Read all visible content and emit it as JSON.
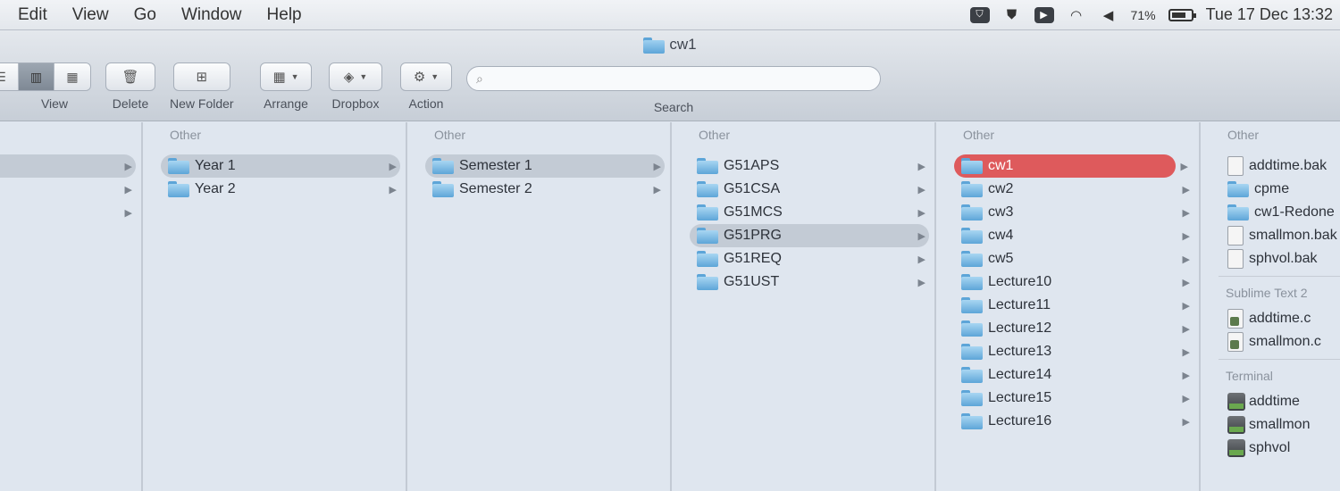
{
  "menubar": {
    "items": [
      "Edit",
      "View",
      "Go",
      "Window",
      "Help"
    ],
    "status": {
      "battery_percent": "71%",
      "clock": "Tue 17 Dec  13:32"
    }
  },
  "window": {
    "title": "cw1"
  },
  "toolbar": {
    "view_label": "View",
    "delete_label": "Delete",
    "new_folder_label": "New Folder",
    "arrange_label": "Arrange",
    "dropbox_label": "Dropbox",
    "action_label": "Action",
    "search_label": "Search",
    "search_value": ""
  },
  "columns": [
    {
      "header": "",
      "items": [
        {
          "name": "",
          "selected": "grey"
        },
        {
          "name": ""
        },
        {
          "name": ""
        }
      ]
    },
    {
      "header": "Other",
      "items": [
        {
          "name": "Year 1",
          "selected": "grey"
        },
        {
          "name": "Year 2"
        }
      ]
    },
    {
      "header": "Other",
      "items": [
        {
          "name": "Semester 1",
          "selected": "grey"
        },
        {
          "name": "Semester 2"
        }
      ]
    },
    {
      "header": "Other",
      "items": [
        {
          "name": "G51APS"
        },
        {
          "name": "G51CSA"
        },
        {
          "name": "G51MCS"
        },
        {
          "name": "G51PRG",
          "selected": "grey"
        },
        {
          "name": "G51REQ"
        },
        {
          "name": "G51UST"
        }
      ]
    },
    {
      "header": "Other",
      "items": [
        {
          "name": "cw1",
          "selected": "red"
        },
        {
          "name": "cw2"
        },
        {
          "name": "cw3"
        },
        {
          "name": "cw4"
        },
        {
          "name": "cw5"
        },
        {
          "name": "Lecture10"
        },
        {
          "name": "Lecture11"
        },
        {
          "name": "Lecture12"
        },
        {
          "name": "Lecture13"
        },
        {
          "name": "Lecture14"
        },
        {
          "name": "Lecture15"
        },
        {
          "name": "Lecture16"
        }
      ]
    }
  ],
  "preview": {
    "other_header": "Other",
    "other_items": [
      "addtime.bak",
      "cpme",
      "cw1-Redone",
      "smallmon.bak",
      "sphvol.bak"
    ],
    "sublime_header": "Sublime Text 2",
    "sublime_items": [
      "addtime.c",
      "smallmon.c"
    ],
    "terminal_header": "Terminal",
    "terminal_items": [
      "addtime",
      "smallmon",
      "sphvol"
    ]
  }
}
